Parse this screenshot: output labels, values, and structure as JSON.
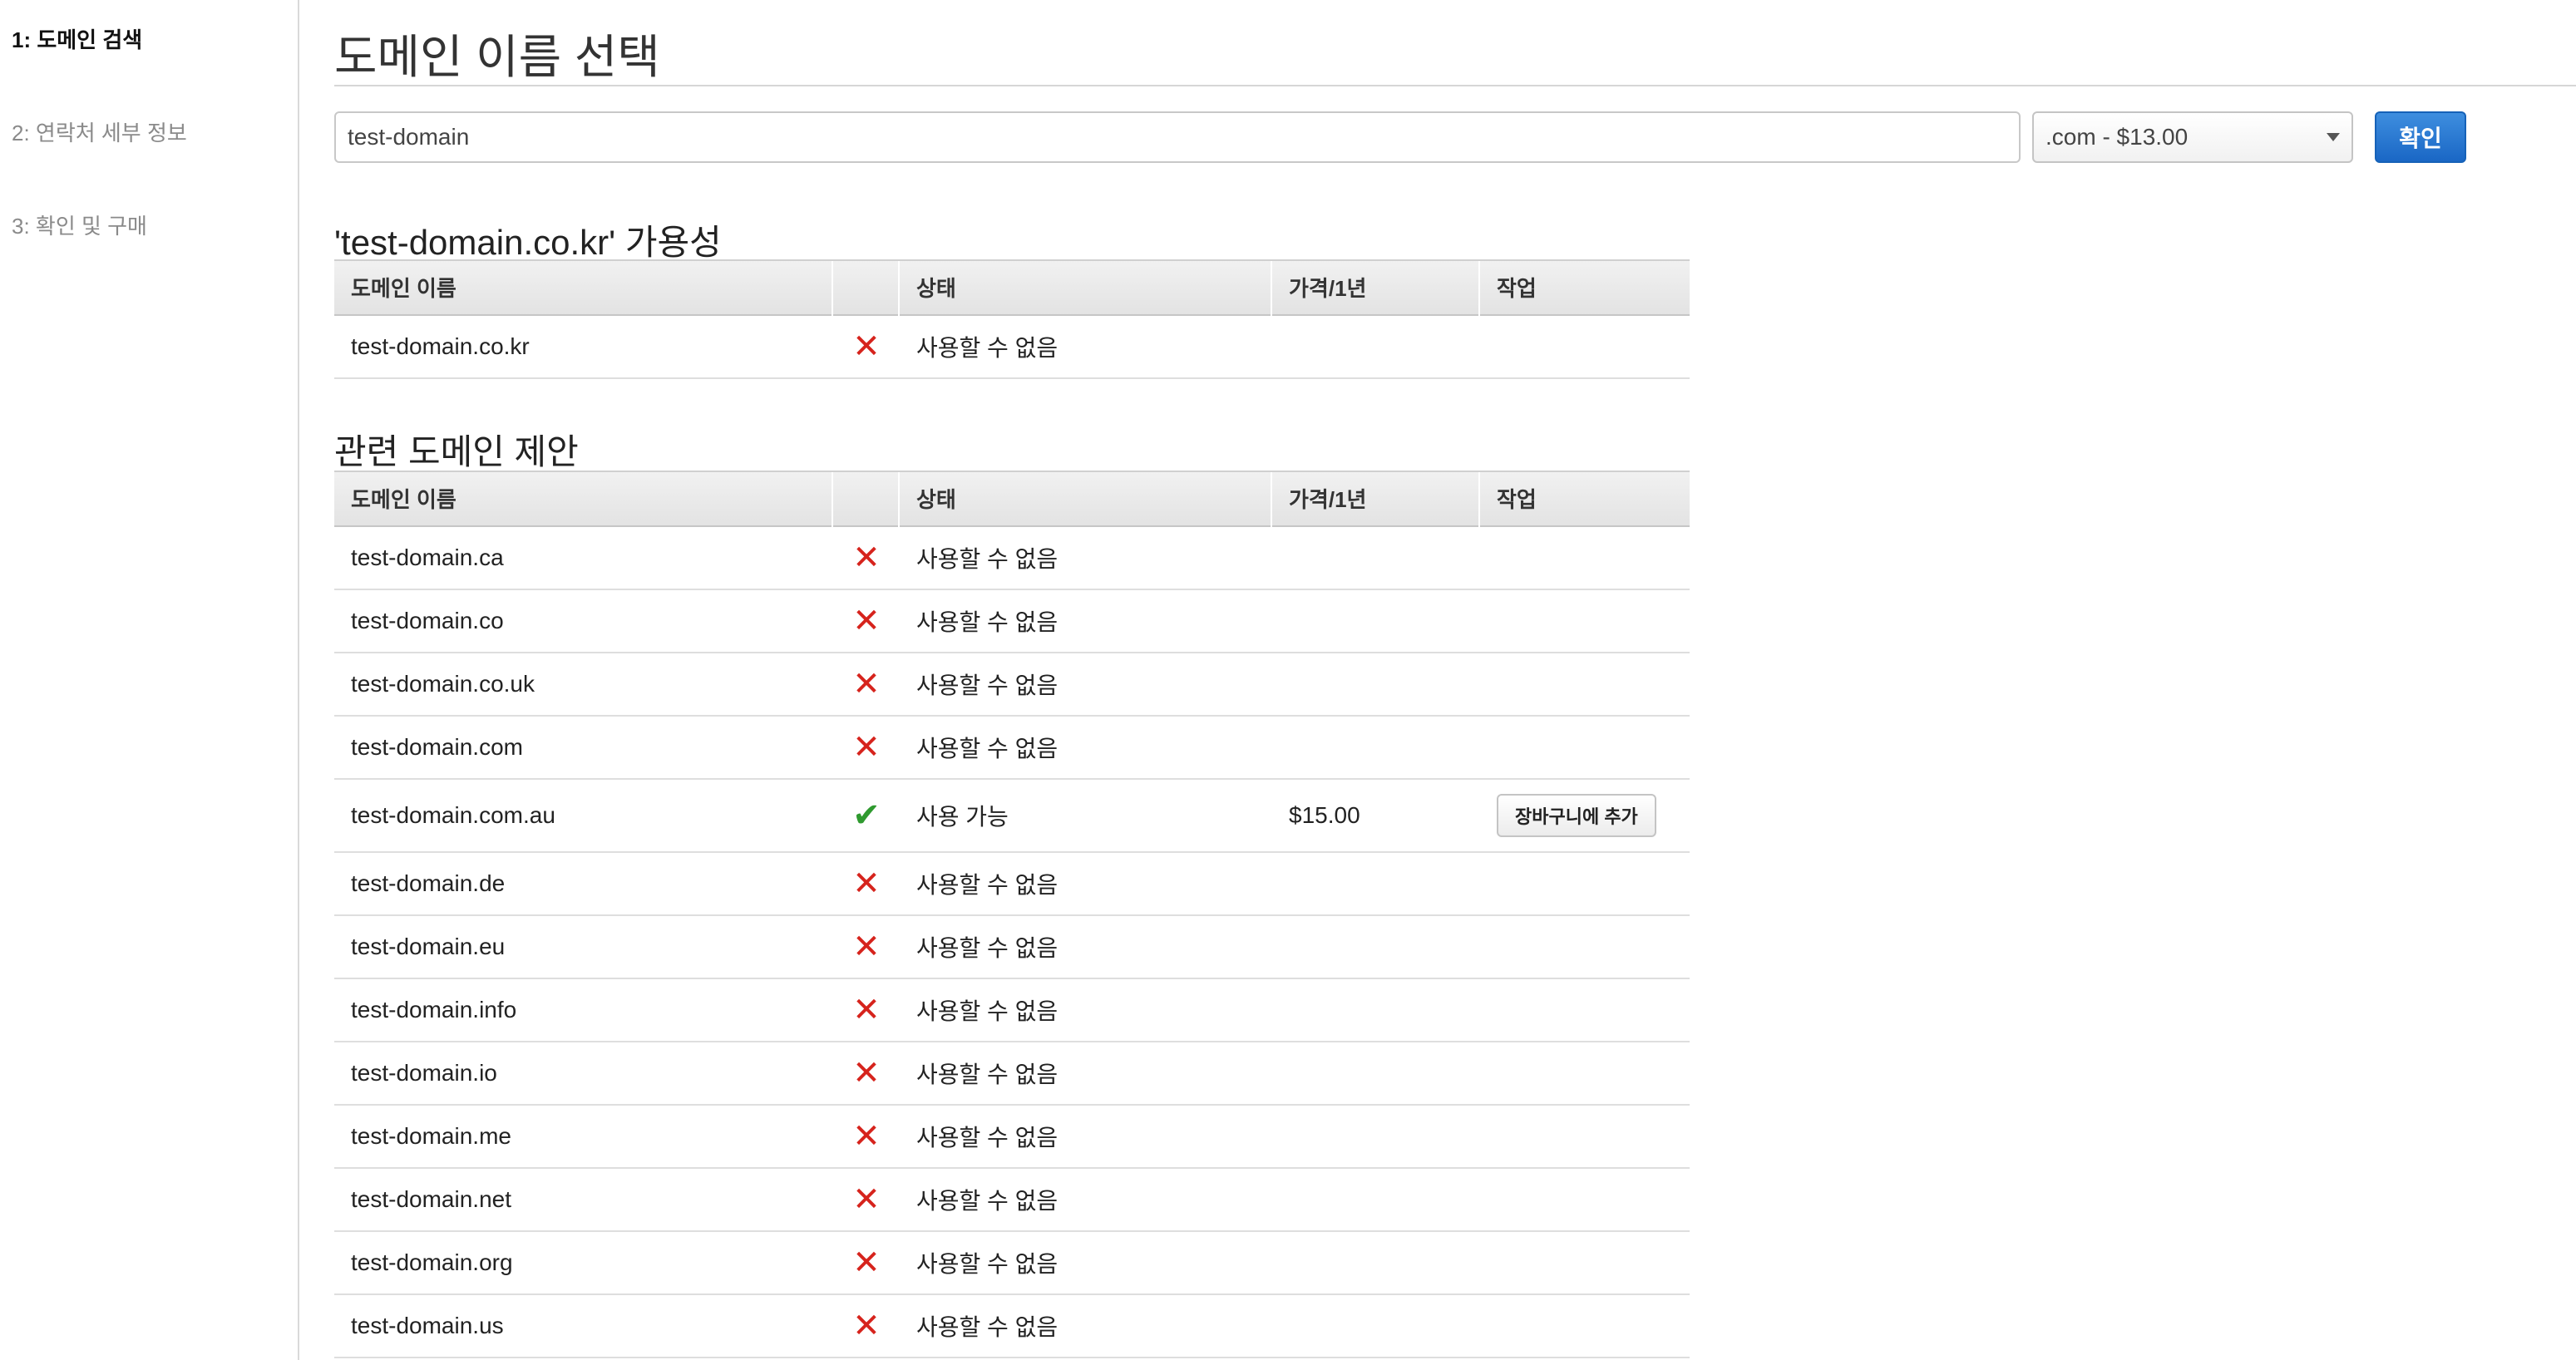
{
  "sidebar": {
    "steps": [
      {
        "label": "1: 도메인 검색",
        "active": true
      },
      {
        "label": "2: 연락처 세부 정보",
        "active": false
      },
      {
        "label": "3: 확인 및 구매",
        "active": false
      }
    ]
  },
  "header": {
    "title": "도메인 이름 선택"
  },
  "search": {
    "value": "test-domain",
    "tld_selected": ".com - $13.00",
    "confirm_label": "확인"
  },
  "columns": {
    "name": "도메인 이름",
    "status": "상태",
    "price": "가격/1년",
    "action": "작업"
  },
  "availability": {
    "title": "'test-domain.co.kr' 가용성",
    "rows": [
      {
        "domain": "test-domain.co.kr",
        "available": false,
        "status": "사용할 수 없음",
        "price": "",
        "action": ""
      }
    ]
  },
  "suggestions": {
    "title": "관련 도메인 제안",
    "rows": [
      {
        "domain": "test-domain.ca",
        "available": false,
        "status": "사용할 수 없음",
        "price": "",
        "action": ""
      },
      {
        "domain": "test-domain.co",
        "available": false,
        "status": "사용할 수 없음",
        "price": "",
        "action": ""
      },
      {
        "domain": "test-domain.co.uk",
        "available": false,
        "status": "사용할 수 없음",
        "price": "",
        "action": ""
      },
      {
        "domain": "test-domain.com",
        "available": false,
        "status": "사용할 수 없음",
        "price": "",
        "action": ""
      },
      {
        "domain": "test-domain.com.au",
        "available": true,
        "status": "사용 가능",
        "price": "$15.00",
        "action": "장바구니에 추가"
      },
      {
        "domain": "test-domain.de",
        "available": false,
        "status": "사용할 수 없음",
        "price": "",
        "action": ""
      },
      {
        "domain": "test-domain.eu",
        "available": false,
        "status": "사용할 수 없음",
        "price": "",
        "action": ""
      },
      {
        "domain": "test-domain.info",
        "available": false,
        "status": "사용할 수 없음",
        "price": "",
        "action": ""
      },
      {
        "domain": "test-domain.io",
        "available": false,
        "status": "사용할 수 없음",
        "price": "",
        "action": ""
      },
      {
        "domain": "test-domain.me",
        "available": false,
        "status": "사용할 수 없음",
        "price": "",
        "action": ""
      },
      {
        "domain": "test-domain.net",
        "available": false,
        "status": "사용할 수 없음",
        "price": "",
        "action": ""
      },
      {
        "domain": "test-domain.org",
        "available": false,
        "status": "사용할 수 없음",
        "price": "",
        "action": ""
      },
      {
        "domain": "test-domain.us",
        "available": false,
        "status": "사용할 수 없음",
        "price": "",
        "action": ""
      }
    ]
  },
  "icons": {
    "unavailable": "x-mark-icon",
    "available": "checkmark-icon"
  },
  "colors": {
    "unavailable": "#d6231c",
    "available": "#2f9a2f",
    "primary_button": "#1a67c5"
  }
}
